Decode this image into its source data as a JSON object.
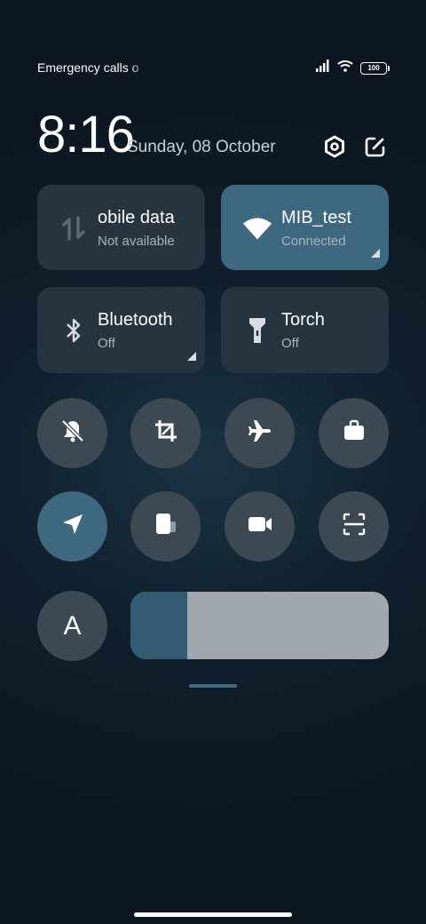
{
  "status_bar": {
    "carrier_text": "Emergency calls o",
    "battery_level": "100",
    "icons": [
      "signal-icon",
      "wifi-icon",
      "battery-icon"
    ]
  },
  "header": {
    "time": "8:16",
    "date": "Sunday, 08 October",
    "icons": [
      "settings-icon",
      "edit-icon"
    ]
  },
  "tiles": [
    {
      "id": "mobile-data",
      "title": "obile data",
      "subtitle": "Not available",
      "icon": "mobile-data-icon",
      "active": false
    },
    {
      "id": "wifi",
      "title": "MIB_test",
      "subtitle": "Connected",
      "icon": "wifi-icon",
      "active": true
    },
    {
      "id": "bluetooth",
      "title": "Bluetooth",
      "subtitle": "Off",
      "icon": "bluetooth-icon",
      "active": false
    },
    {
      "id": "torch",
      "title": "Torch",
      "subtitle": "Off",
      "icon": "torch-icon",
      "active": false
    }
  ],
  "toggles": [
    {
      "id": "mute",
      "icon": "bell-off-icon",
      "active": false
    },
    {
      "id": "screenshot",
      "icon": "crop-icon",
      "active": false
    },
    {
      "id": "airplane",
      "icon": "airplane-icon",
      "active": false
    },
    {
      "id": "work",
      "icon": "briefcase-icon",
      "active": false
    },
    {
      "id": "location",
      "icon": "location-arrow-icon",
      "active": true
    },
    {
      "id": "floating-window",
      "icon": "floating-window-icon",
      "active": false
    },
    {
      "id": "screen-recorder",
      "icon": "video-camera-icon",
      "active": false
    },
    {
      "id": "scanner",
      "icon": "scan-icon",
      "active": false
    }
  ],
  "font_size_toggle": {
    "label": "A"
  },
  "brightness": {
    "level_fraction": 0.22
  },
  "colors": {
    "active": "#3e6880",
    "tile": "#26343f",
    "round": "#3c4852"
  }
}
